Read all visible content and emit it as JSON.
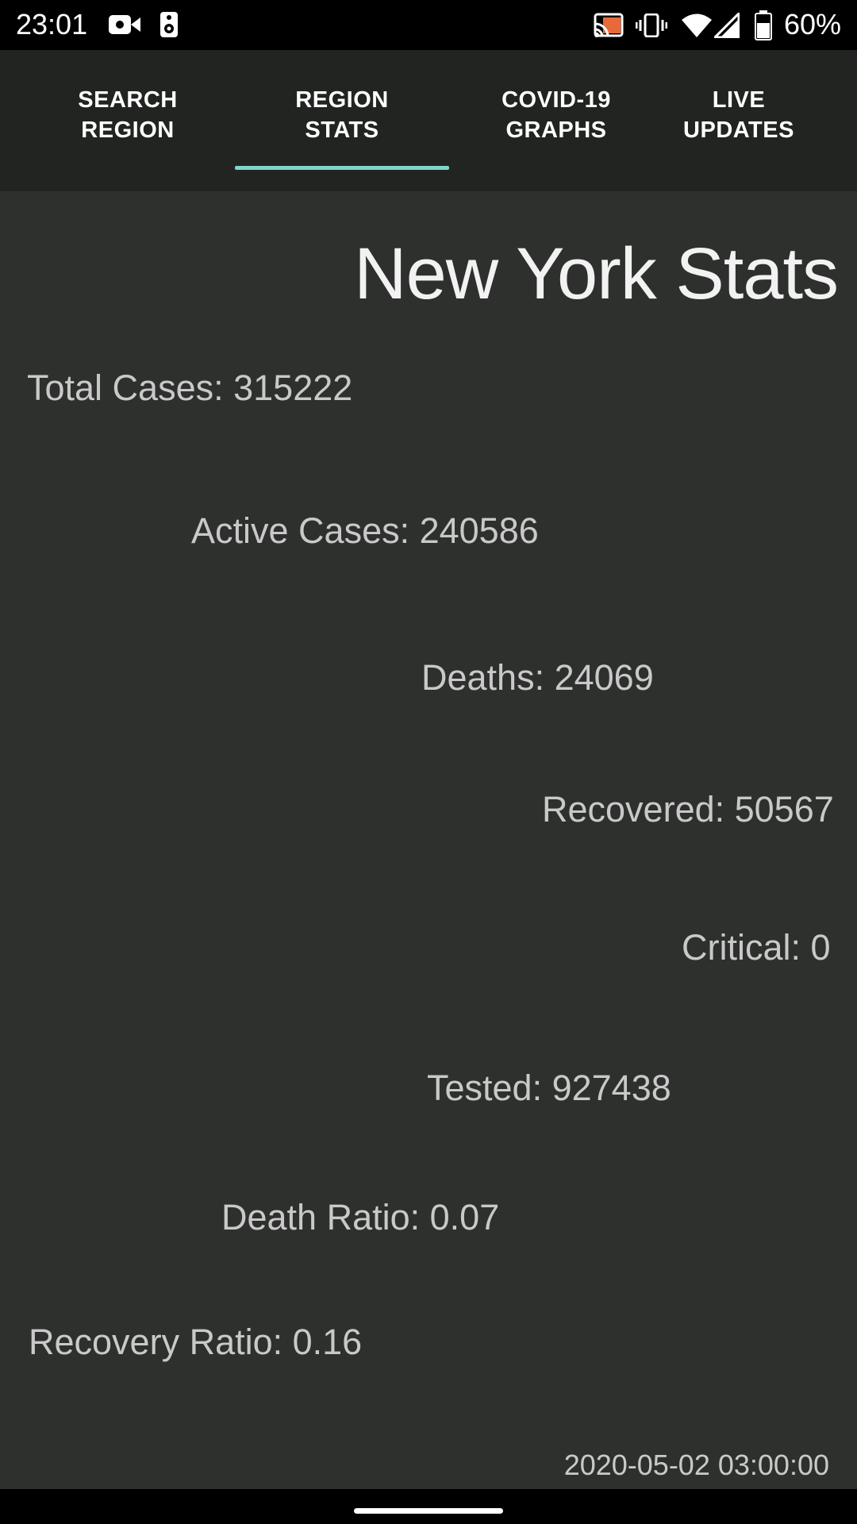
{
  "status_bar": {
    "time": "23:01",
    "battery_percent": "60%",
    "icons": [
      "video-camera-icon",
      "speaker-icon",
      "cast-icon",
      "vibrate-icon",
      "wifi-icon",
      "cell-signal-icon",
      "battery-icon"
    ]
  },
  "tabs": [
    {
      "label": "SEARCH\nREGION",
      "selected": false
    },
    {
      "label": "REGION\nSTATS",
      "selected": true
    },
    {
      "label": "COVID-19\nGRAPHS",
      "selected": false
    },
    {
      "label": "LIVE\nUPDATES",
      "selected": false
    }
  ],
  "accent_color": "#7fd6c9",
  "page": {
    "title": "New York Stats",
    "stats": [
      {
        "text": "Total Cases: 315222"
      },
      {
        "text": "Active Cases: 240586"
      },
      {
        "text": "Deaths: 24069"
      },
      {
        "text": "Recovered: 50567"
      },
      {
        "text": "Critical: 0"
      },
      {
        "text": "Tested: 927438"
      },
      {
        "text": "Death Ratio: 0.07"
      },
      {
        "text": "Recovery Ratio: 0.16"
      }
    ],
    "updated_at": "2020-05-02 03:00:00"
  }
}
